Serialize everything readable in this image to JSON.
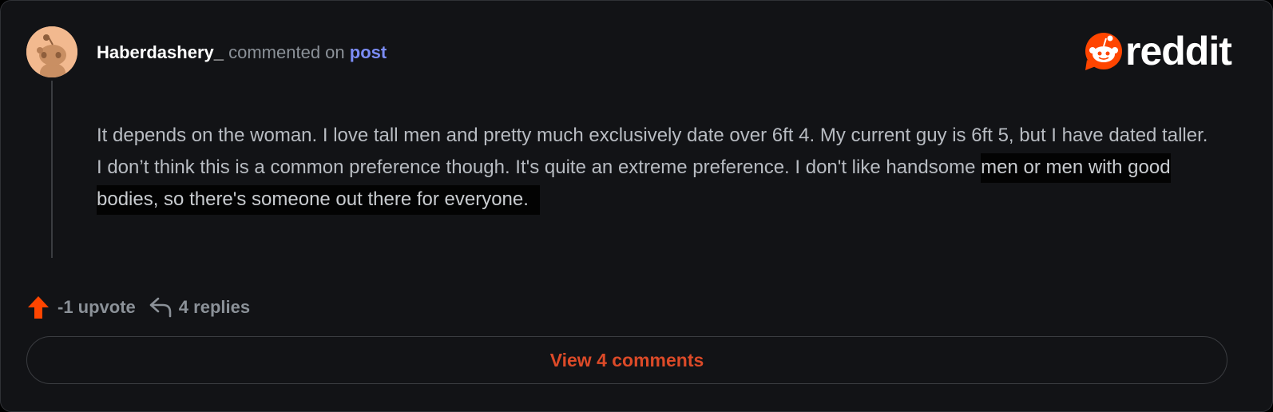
{
  "comment": {
    "username": "Haberdashery_",
    "action_text": "commented on",
    "post_link": "post",
    "body_part1": "It depends on the woman. I love tall men and pretty much exclusively date over 6ft 4. My current guy is 6ft 5, but I have dated taller. I don’t think this is a common preference though. It's quite an extreme preference. I don't like handsome ",
    "body_highlighted": "men or men with good bodies, so there's someone out there for everyone."
  },
  "brand": {
    "wordmark": "reddit",
    "accent_color": "#ff4500"
  },
  "actions": {
    "upvote_label": "-1 upvote",
    "replies_label": "4 replies",
    "upvote_icon": "upvote-arrow-icon",
    "reply_icon": "reply-arrow-icon"
  },
  "footer": {
    "view_comments_label": "View 4 comments"
  },
  "colors": {
    "background": "#121316",
    "username": "#ffffff",
    "link": "#7b8cf5",
    "muted": "#8b9198",
    "view_button_text": "#dc4a28"
  }
}
